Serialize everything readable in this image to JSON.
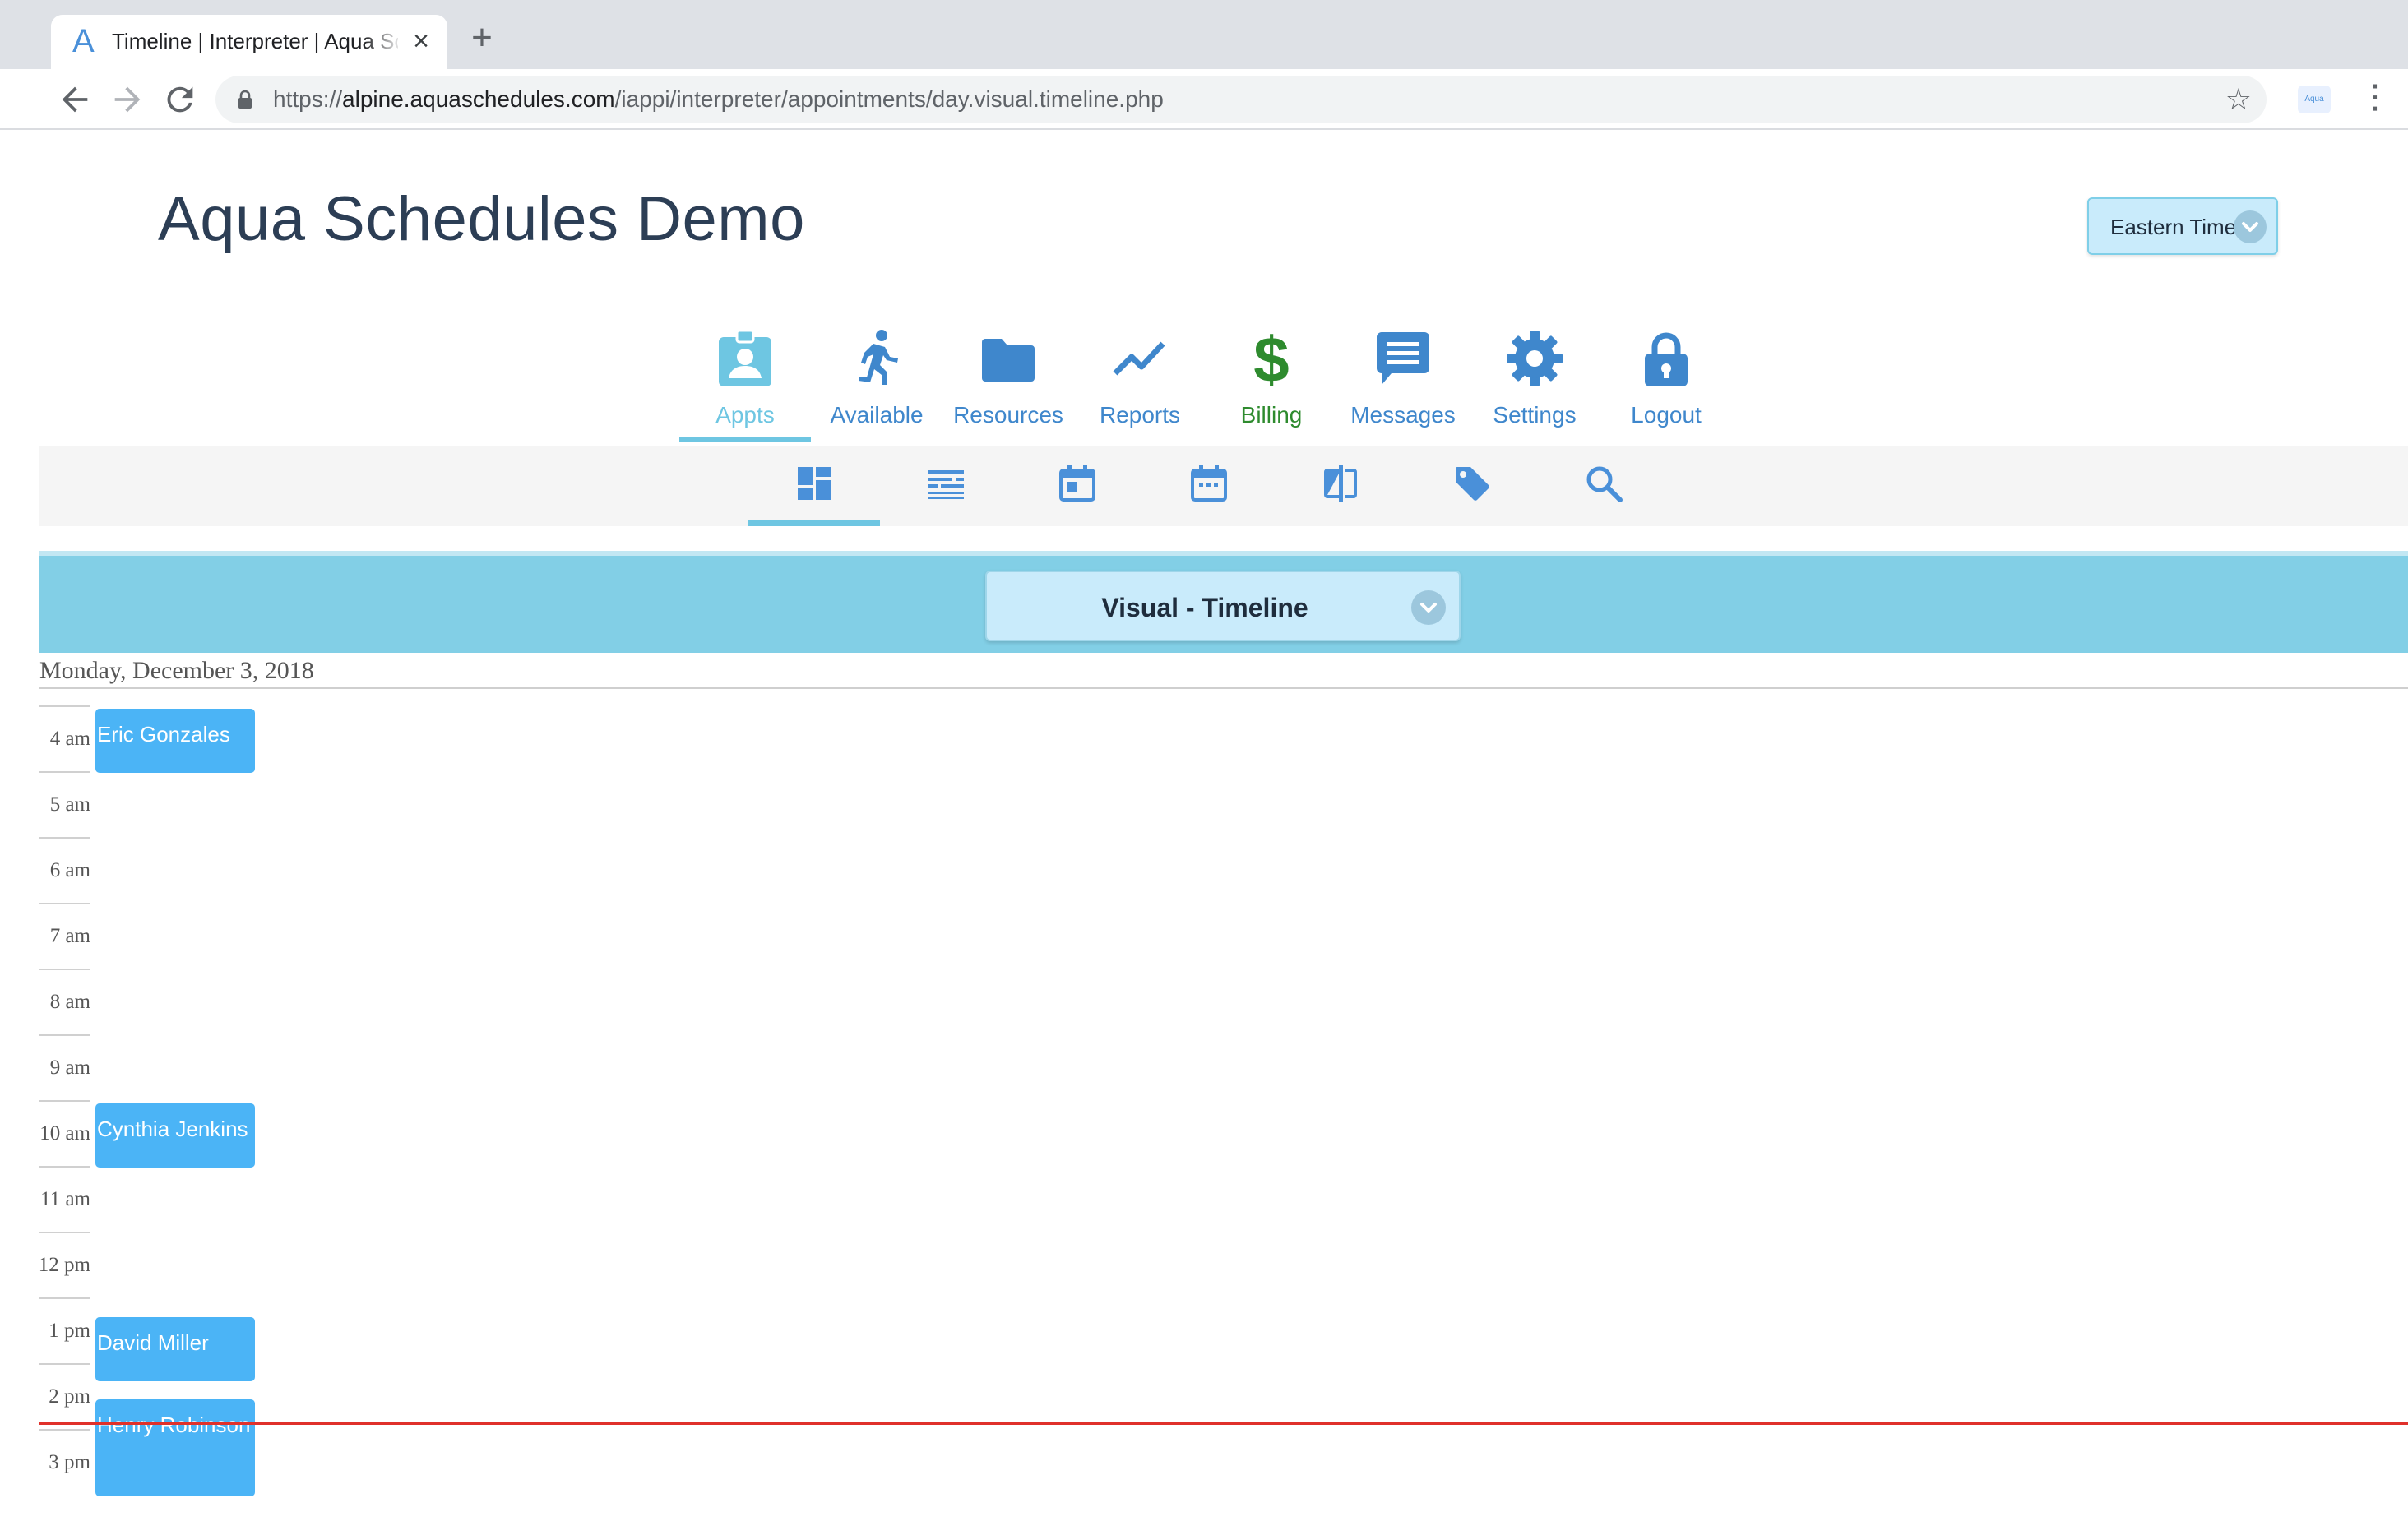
{
  "browser": {
    "tab_title": "Timeline | Interpreter | Aqua Schedules",
    "tab_favicon": "A",
    "url_scheme": "https://",
    "url_host": "alpine.aquaschedules.com",
    "url_path": "/iappi/interpreter/appointments/day.visual.timeline.php",
    "extension_label": "Aqua"
  },
  "header": {
    "title": "Aqua Schedules Demo",
    "timezone": "Eastern Time"
  },
  "nav": {
    "items": [
      {
        "label": "Appts",
        "icon": "appts-badge-icon",
        "active": true,
        "color": "#6ec6e2"
      },
      {
        "label": "Available",
        "icon": "running-person-icon",
        "color": "#3f87cc"
      },
      {
        "label": "Resources",
        "icon": "folder-icon",
        "color": "#3f87cc"
      },
      {
        "label": "Reports",
        "icon": "line-chart-icon",
        "color": "#3f87cc"
      },
      {
        "label": "Billing",
        "icon": "dollar-icon",
        "color": "#2e8b2e"
      },
      {
        "label": "Messages",
        "icon": "message-icon",
        "color": "#3f87cc"
      },
      {
        "label": "Settings",
        "icon": "gear-icon",
        "color": "#3f87cc"
      },
      {
        "label": "Logout",
        "icon": "lock-icon",
        "color": "#3f87cc"
      }
    ]
  },
  "subnav": {
    "items": [
      {
        "icon": "dashboard-icon",
        "active": true
      },
      {
        "icon": "list-view-icon"
      },
      {
        "icon": "calendar-day-icon"
      },
      {
        "icon": "calendar-month-icon"
      },
      {
        "icon": "compare-icon"
      },
      {
        "icon": "tag-icon"
      },
      {
        "icon": "search-icon"
      }
    ]
  },
  "view": {
    "selected": "Visual - Timeline"
  },
  "date": "Monday, December 3, 2018",
  "timeline": {
    "hours": [
      "4 am",
      "5 am",
      "6 am",
      "7 am",
      "8 am",
      "9 am",
      "10 am",
      "11 am",
      "12 pm",
      "1 pm",
      "2 pm",
      "3 pm"
    ],
    "appointments": [
      {
        "name": "Eric Gonzales",
        "start_hour": 4.0,
        "end_hour": 5.0
      },
      {
        "name": "Cynthia Jenkins",
        "start_hour": 10.0,
        "end_hour": 11.0
      },
      {
        "name": "David Miller",
        "start_hour": 13.25,
        "end_hour": 14.25
      },
      {
        "name": "Henry Robinson",
        "start_hour": 14.5,
        "end_hour": 16.0
      }
    ],
    "current_time_hour": 14.9
  },
  "colors": {
    "accent": "#82cfe6",
    "nav_blue": "#3f87cc",
    "billing_green": "#2e8b2e",
    "appointment": "#4bb4f6",
    "now_line": "#e0312b"
  }
}
